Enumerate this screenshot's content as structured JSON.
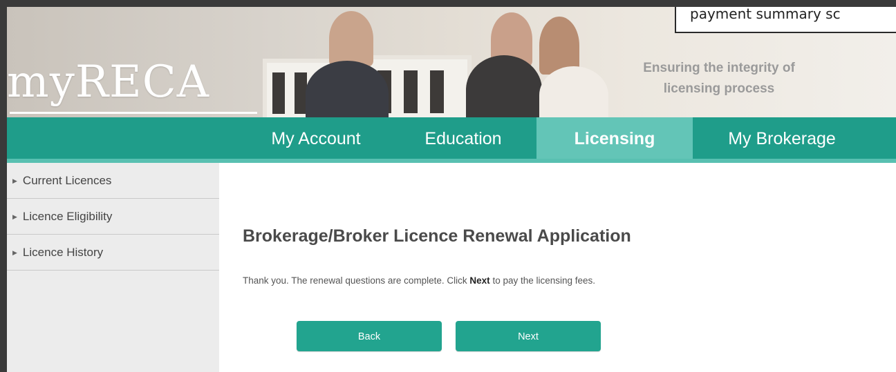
{
  "banner": {
    "logo_text": "myRECA",
    "tagline_line1": "Ensuring the integrity of",
    "tagline_line2": "licensing process"
  },
  "callout": {
    "text": "payment summary sc"
  },
  "nav": {
    "items": [
      {
        "label": "My Account",
        "active": false
      },
      {
        "label": "Education",
        "active": false
      },
      {
        "label": "Licensing",
        "active": true
      },
      {
        "label": "My Brokerage",
        "active": false
      }
    ]
  },
  "sidebar": {
    "items": [
      {
        "label": "Current Licences"
      },
      {
        "label": "Licence Eligibility"
      },
      {
        "label": "Licence History"
      }
    ]
  },
  "main": {
    "title": "Brokerage/Broker Licence Renewal Application",
    "message_before": "Thank you. The renewal questions are complete. Click ",
    "message_bold": "Next",
    "message_after": " to pay the licensing fees.",
    "back_label": "Back",
    "next_label": "Next"
  },
  "colors": {
    "brand_teal": "#1f9d8a",
    "active_tab": "#63c5b7",
    "button": "#22a48f"
  }
}
